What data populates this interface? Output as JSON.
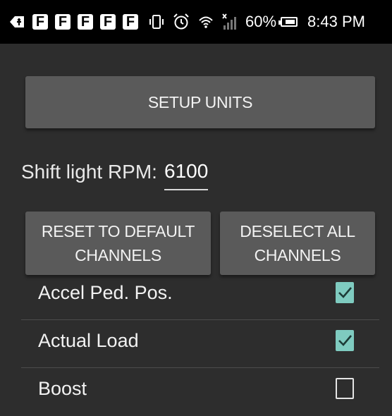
{
  "status_bar": {
    "back_icon": "back-icon",
    "notification_icons": [
      "F",
      "F",
      "F",
      "F",
      "F"
    ],
    "battery_percent": "60%",
    "time": "8:43 PM"
  },
  "setup_units_button": {
    "label": "SETUP UNITS"
  },
  "shift_light": {
    "label": "Shift light RPM:",
    "value": "6100"
  },
  "reset_button": {
    "label": "RESET TO DEFAULT\nCHANNELS"
  },
  "deselect_button": {
    "label": "DESELECT ALL\nCHANNELS"
  },
  "channels": [
    {
      "label": "Accel Ped. Pos.",
      "checked": true
    },
    {
      "label": "Actual Load",
      "checked": true
    },
    {
      "label": "Boost",
      "checked": false
    }
  ],
  "colors": {
    "background": "#2d2d2d",
    "button": "#5a5a5a",
    "checkbox_checked": "#7fcbc0"
  }
}
